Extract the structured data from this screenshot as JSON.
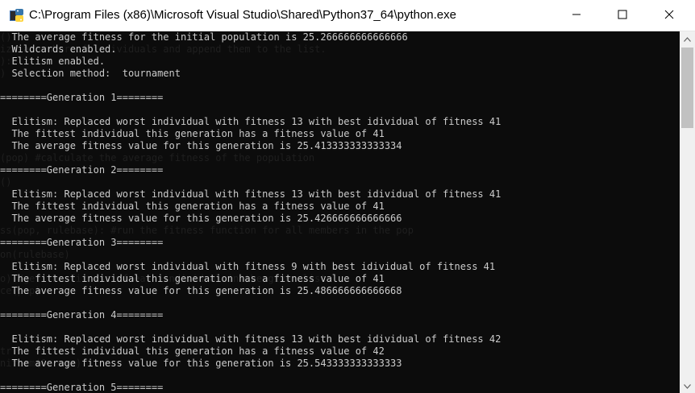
{
  "window": {
    "title": "C:\\Program Files (x86)\\Microsoft Visual Studio\\Shared\\Python37_64\\python.exe",
    "app_icon": "python-icon"
  },
  "controls": {
    "minimize_icon": "minimize-icon",
    "maximize_icon": "maximize-icon",
    "close_icon": "close-icon"
  },
  "background_code": [
    "()",
    "ize a number of individuals and append them to the list.",
    "):",
    ")",
    "",
    "",
    "",
    "",
    "",
    "",
    "(pop) #calculate the average fitness of the population",
    "",
    "()",
    "",
    "",
    "",
    "ss(pop, rulebase): #run the fitness function for all members in the pop",
    "",
    "on(rulebase)",
    "",
    "o) #get the fitness of each individual in the given list",
    "ce(pop)",
    "",
    "",
    "",
    "",
    "tr",
    "niform(0, max)"
  ],
  "console_lines": [
    "  The average fitness for the initial population is 25.266666666666666",
    "  Wildcards enabled.",
    "  Elitism enabled.",
    "  Selection method:  tournament",
    "",
    "========Generation 1========",
    "",
    "  Elitism: Replaced worst individual with fitness 13 with best idividual of fitness 41",
    "  The fittest individual this generation has a fitness value of 41",
    "  The average fitness value for this generation is 25.413333333333334",
    "",
    "========Generation 2========",
    "",
    "  Elitism: Replaced worst individual with fitness 13 with best idividual of fitness 41",
    "  The fittest individual this generation has a fitness value of 41",
    "  The average fitness value for this generation is 25.426666666666666",
    "",
    "========Generation 3========",
    "",
    "  Elitism: Replaced worst individual with fitness 9 with best idividual of fitness 41",
    "  The fittest individual this generation has a fitness value of 41",
    "  The average fitness value for this generation is 25.486666666666668",
    "",
    "========Generation 4========",
    "",
    "  Elitism: Replaced worst individual with fitness 13 with best idividual of fitness 42",
    "  The fittest individual this generation has a fitness value of 42",
    "  The average fitness value for this generation is 25.543333333333333",
    "",
    "========Generation 5========"
  ],
  "scrollbar": {
    "up_icon": "scroll-up-arrow-icon",
    "down_icon": "scroll-down-arrow-icon"
  }
}
